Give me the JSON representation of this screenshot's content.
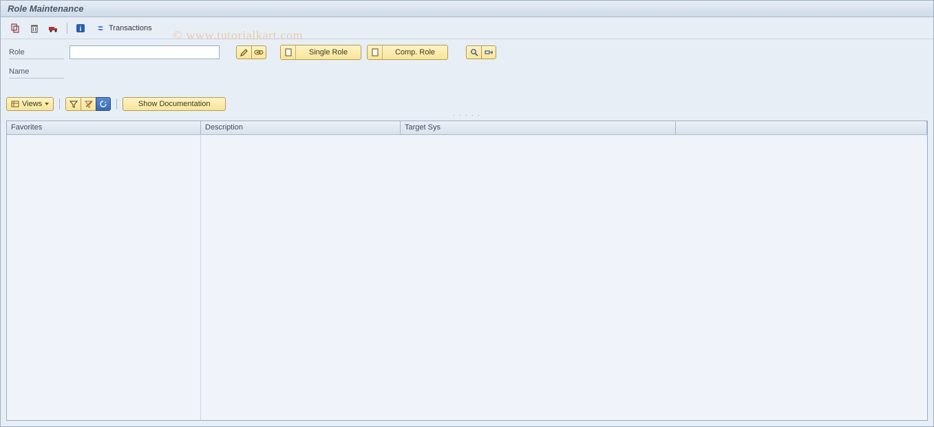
{
  "header": {
    "title": "Role Maintenance"
  },
  "toolbar": {
    "transactions_label": "Transactions"
  },
  "form": {
    "role_label": "Role",
    "role_value": "",
    "name_label": "Name",
    "single_role_label": "Single Role",
    "comp_role_label": "Comp. Role"
  },
  "grid_toolbar": {
    "views_label": "Views",
    "show_docs_label": "Show Documentation"
  },
  "table": {
    "col_favorites": "Favorites",
    "col_description": "Description",
    "col_target": "Target Sys"
  },
  "watermark": "© www.tutorialkart.com"
}
